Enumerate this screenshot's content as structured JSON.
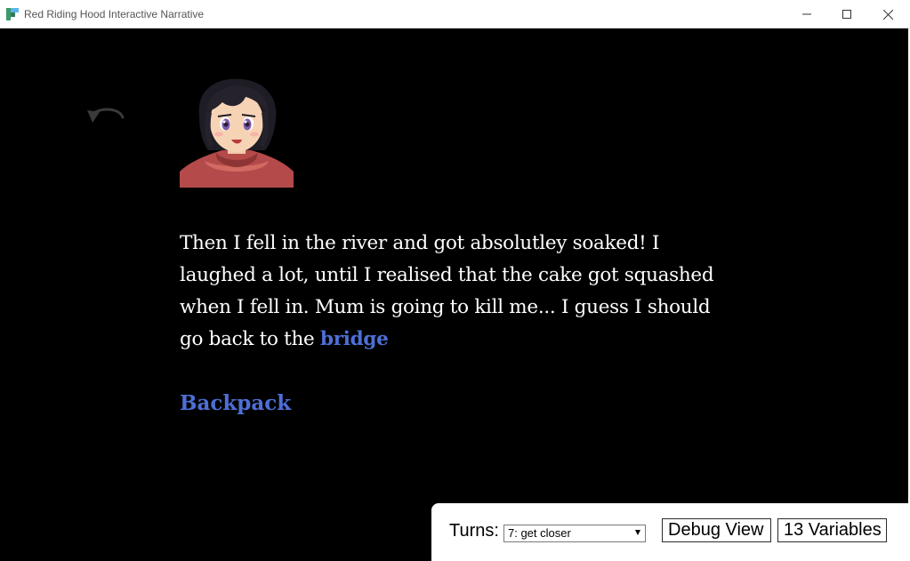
{
  "window": {
    "title": "Red Riding Hood Interactive Narrative"
  },
  "story": {
    "passage_text": "Then I fell in the river and got absolutley soaked! I laughed a lot, until I realised that the cake got squashed when I fell in. Mum is going to kill me... I guess I should go back to the ",
    "link_bridge": "bridge",
    "link_backpack": "Backpack",
    "portrait_icon": "character-portrait",
    "undo_icon": "undo-icon"
  },
  "debug": {
    "turns_label": "Turns:",
    "turns_selected": "7: get closer",
    "debug_view_label": "Debug View",
    "variables_label": "13 Variables"
  },
  "colors": {
    "background": "#000000",
    "text": "#ffffff",
    "link": "#4d6fd6"
  }
}
